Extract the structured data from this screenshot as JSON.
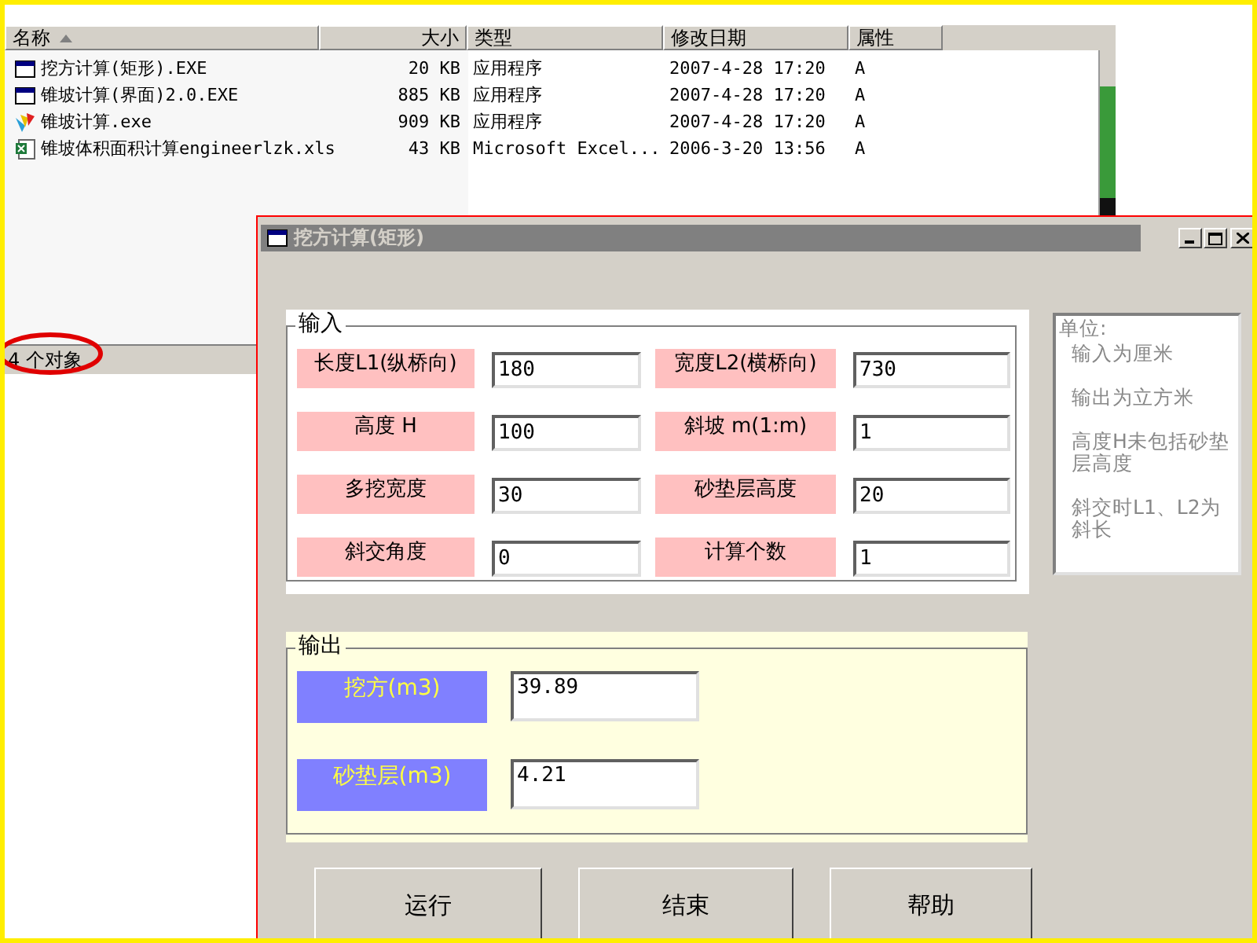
{
  "explorer": {
    "columns": [
      {
        "label": "名称",
        "sorted": true
      },
      {
        "label": "大小",
        "sorted": false
      },
      {
        "label": "类型",
        "sorted": false
      },
      {
        "label": "修改日期",
        "sorted": false
      },
      {
        "label": "属性",
        "sorted": false
      }
    ],
    "rows": [
      {
        "kind": "program",
        "name": "挖方计算(矩形).EXE",
        "size": "20 KB",
        "type": "应用程序",
        "modified": "2007-4-28 17:20",
        "attributes": "A"
      },
      {
        "kind": "program",
        "name": "锥坡计算(界面)2.0.EXE",
        "size": "885 KB",
        "type": "应用程序",
        "modified": "2007-4-28 17:20",
        "attributes": "A"
      },
      {
        "kind": "logo",
        "name": "锥坡计算.exe",
        "size": "909 KB",
        "type": "应用程序",
        "modified": "2007-4-28 17:20",
        "attributes": "A"
      },
      {
        "kind": "spreadsheet",
        "name": "锥坡体积面积计算engineerlzk.xls",
        "size": "43 KB",
        "type": "Microsoft Excel...",
        "modified": "2006-3-20 13:56",
        "attributes": "A"
      }
    ],
    "status": "4 个对象"
  },
  "dialog": {
    "title": "挖方计算(矩形)",
    "input": {
      "legend": "输入",
      "fields": [
        {
          "label": "长度L1(纵桥向)",
          "value": "180"
        },
        {
          "label": "宽度L2(横桥向)",
          "value": "730"
        },
        {
          "label": "高度 H",
          "value": "100"
        },
        {
          "label": "斜坡 m(1:m)",
          "value": "1"
        },
        {
          "label": "多挖宽度",
          "value": "30"
        },
        {
          "label": "砂垫层高度",
          "value": "20"
        },
        {
          "label": "斜交角度",
          "value": "0"
        },
        {
          "label": "计算个数",
          "value": "1"
        }
      ]
    },
    "units": {
      "title": "单位:",
      "notes": [
        "输入为厘米",
        "输出为立方米",
        "高度H未包括砂垫层高度",
        "斜交时L1、L2为斜长"
      ]
    },
    "output": {
      "legend": "输出",
      "fields": [
        {
          "label": "挖方(m3)",
          "value": "39.89"
        },
        {
          "label": "砂垫层(m3)",
          "value": "4.21"
        }
      ]
    },
    "buttons": [
      "运行",
      "结束",
      "帮助"
    ]
  }
}
